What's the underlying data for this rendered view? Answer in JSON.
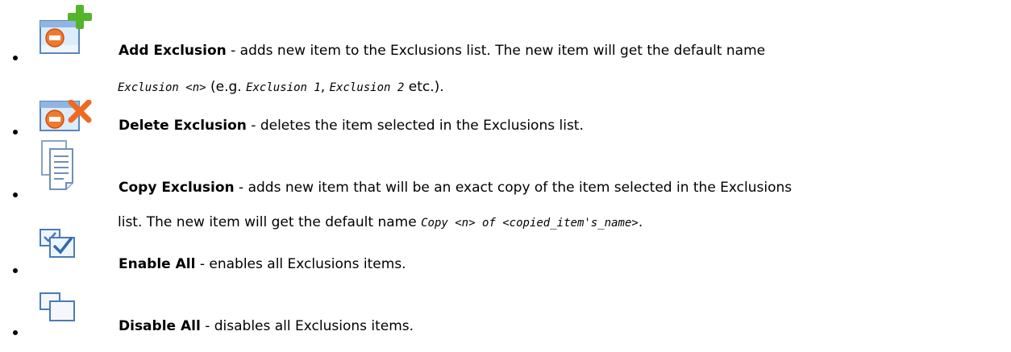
{
  "items": [
    {
      "icon": "add-exclusion-icon",
      "label": "Add Exclusion",
      "text": " - adds new item to the Exclusions list. The new item will get the default name",
      "cont": {
        "code1": "Exclusion <n>",
        "t1": " (e.g. ",
        "code2": "Exclusion 1",
        "t2": ", ",
        "code3": "Exclusion 2",
        "t3": " etc.)."
      }
    },
    {
      "icon": "delete-exclusion-icon",
      "label": "Delete Exclusion",
      "text": " - deletes the item selected in the Exclusions list."
    },
    {
      "icon": "copy-exclusion-icon",
      "label": "Copy Exclusion",
      "text": " - adds new item that will be an exact copy of the item selected in the Exclusions",
      "cont": {
        "t1": "list. The new item will get the default name ",
        "code1": "Copy <n> of <copied_item's_name>",
        "t2": "."
      }
    },
    {
      "icon": "enable-all-icon",
      "label": "Enable All",
      "text": " - enables all Exclusions items."
    },
    {
      "icon": "disable-all-icon",
      "label": "Disable All",
      "text": " - disables all Exclusions items."
    }
  ]
}
